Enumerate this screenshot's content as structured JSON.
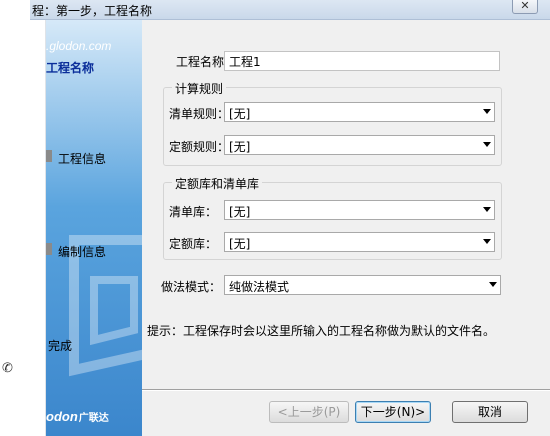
{
  "window": {
    "title": "程：第一步，工程名称",
    "close_glyph": "✕"
  },
  "wizard": {
    "brand_url": ".glodon.com",
    "current_step": "工程名称",
    "steps": [
      "工程信息",
      "编制信息",
      "完成"
    ],
    "brand_logo": "odon",
    "brand_logo_cn": "广联达"
  },
  "form": {
    "project_name_label": "工程名称：",
    "project_name_value": "工程1",
    "calc_rules_group": "计算规则",
    "bill_rule_label": "清单规则：",
    "bill_rule_value": "[无]",
    "quota_rule_label": "定额规则：",
    "quota_rule_value": "[无]",
    "library_group": "定额库和清单库",
    "bill_lib_label": "清单库：",
    "bill_lib_value": "[无]",
    "quota_lib_label": "定额库：",
    "quota_lib_value": "[无]",
    "method_label": "做法模式：",
    "method_value": "纯做法模式",
    "hint": "提示：工程保存时会以这里所输入的工程名称做为默认的文件名。"
  },
  "buttons": {
    "prev": "<上一步(P)",
    "next": "下一步(N)>",
    "cancel": "取消"
  },
  "icons": {
    "side_icon": "phone-icon",
    "dropdown": "chevron-down-icon"
  },
  "colors": {
    "panel_blue": "#3b86cc",
    "active_step": "#0a2e9a",
    "dialog_bg": "#f0f0f0"
  }
}
